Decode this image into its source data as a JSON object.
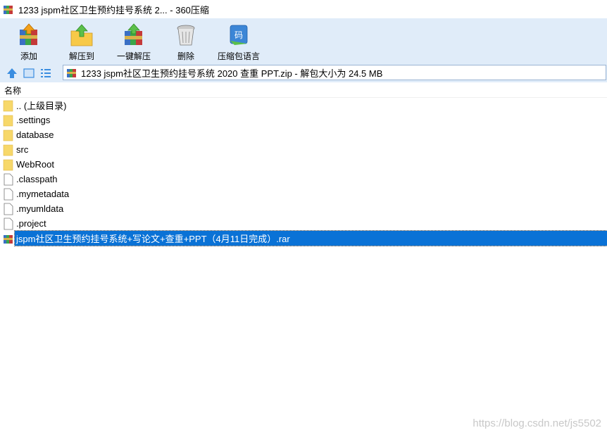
{
  "window": {
    "title": "1233 jspm社区卫生预约挂号系统 2... - 360压缩",
    "app_icon": "winrar-books-icon"
  },
  "toolbar": {
    "buttons": [
      {
        "label": "添加",
        "icon": "add-archive-icon"
      },
      {
        "label": "解压到",
        "icon": "extract-to-folder-icon"
      },
      {
        "label": "一键解压",
        "icon": "one-click-extract-icon"
      },
      {
        "label": "删除",
        "icon": "trash-can-icon"
      },
      {
        "label": "压缩包语言",
        "icon": "archive-language-icon"
      }
    ]
  },
  "addressbar": {
    "path": "1233 jspm社区卫生预约挂号系统 2020 查重 PPT.zip - 解包大小为 24.5 MB"
  },
  "list": {
    "column_name": "名称",
    "items": [
      {
        "name": ".. (上级目录)",
        "type": "folder"
      },
      {
        "name": ".settings",
        "type": "folder"
      },
      {
        "name": "database",
        "type": "folder"
      },
      {
        "name": "src",
        "type": "folder"
      },
      {
        "name": "WebRoot",
        "type": "folder"
      },
      {
        "name": ".classpath",
        "type": "file"
      },
      {
        "name": ".mymetadata",
        "type": "file"
      },
      {
        "name": ".myumldata",
        "type": "file"
      },
      {
        "name": ".project",
        "type": "file"
      },
      {
        "name": "jspm社区卫生预约挂号系统+写论文+查重+PPT（4月11日完成）.rar",
        "type": "archive",
        "selected": true
      }
    ]
  },
  "watermark": "https://blog.csdn.net/js5502",
  "colors": {
    "toolbar_bg": "#e0ecf9",
    "selection": "#0a72d6",
    "folder": "#f7d86a"
  }
}
